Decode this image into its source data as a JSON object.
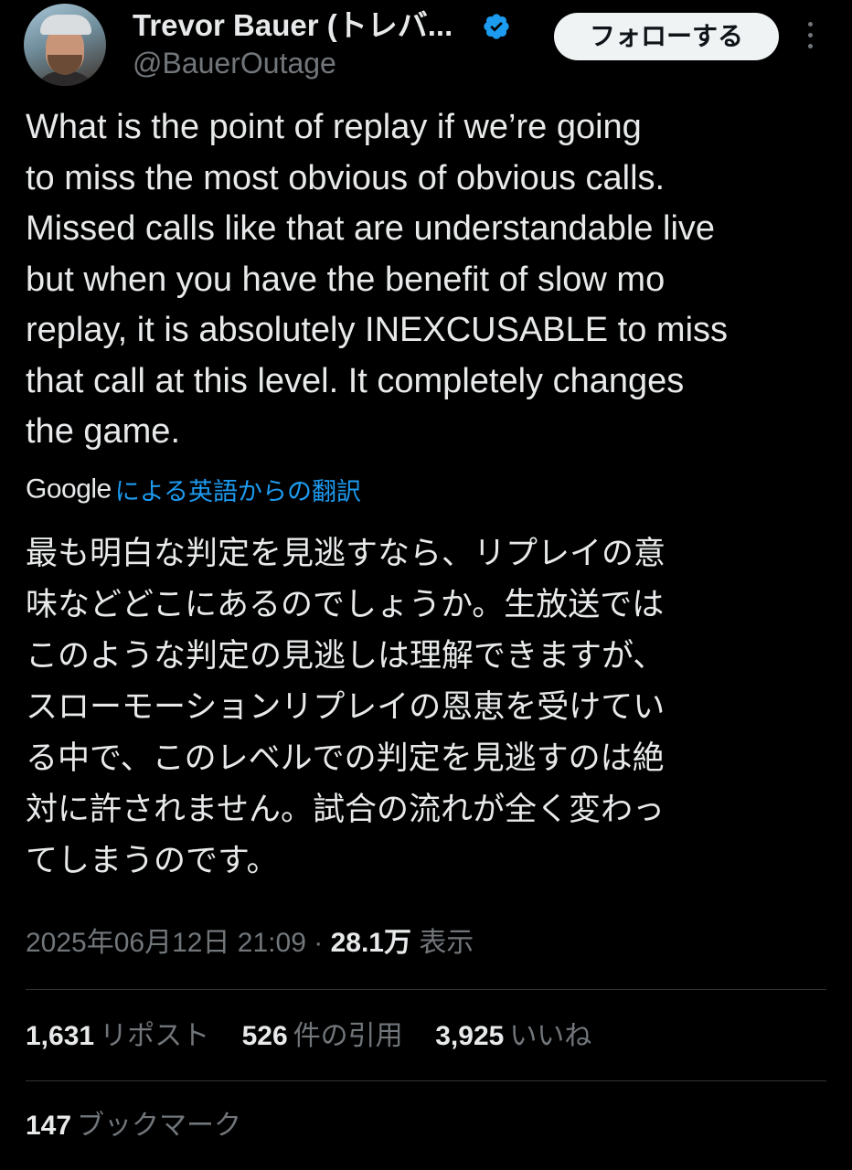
{
  "author": {
    "display_name": "Trevor Bauer (トレバ...",
    "handle": "@BauerOutage",
    "verified_color": "#1d9bf0"
  },
  "follow_button": {
    "label": "フォローする"
  },
  "tweet": {
    "text": "What is the point of replay if we’re going\nto miss the most obvious of obvious calls.\nMissed calls like that are understandable live\nbut when you have the benefit of slow mo\nreplay, it is absolutely INEXCUSABLE to miss\nthat call at this level. It completely changes\nthe game.",
    "translation_provider": "Google",
    "translation_label": "による英語からの翻訳",
    "translated_text": "最も明白な判定を見逃すなら、リプレイの意\n味などどこにあるのでしょうか。生放送では\nこのような判定の見逃しは理解できますが、\nスローモーションリプレイの恩恵を受けてい\nる中で、このレベルでの判定を見逃すのは絶\n対に許されません。試合の流れが全く変わっ\nてしまうのです。",
    "timestamp": "2025年06月12日 21:09",
    "separator": "·",
    "views_count": "28.1万",
    "views_label": "表示"
  },
  "stats": {
    "reposts": {
      "count": "1,631",
      "label": "リポスト"
    },
    "quotes": {
      "count": "526",
      "label": "件の引用"
    },
    "likes": {
      "count": "3,925",
      "label": "いいね"
    },
    "bookmarks": {
      "count": "147",
      "label": "ブックマーク"
    }
  },
  "colors": {
    "background": "#000000",
    "text_primary": "#e7e9ea",
    "text_secondary": "#71767b",
    "link": "#1d9bf0",
    "divider": "#2f3336"
  },
  "icons": {
    "verified": "verified-badge-icon",
    "more": "more-options-icon"
  }
}
